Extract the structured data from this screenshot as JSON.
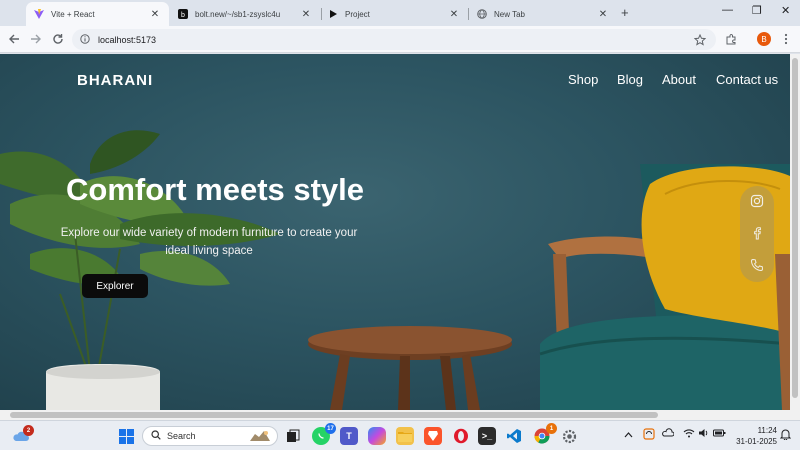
{
  "browser": {
    "tabs": [
      {
        "title": "Vite + React",
        "icon": "vite-icon",
        "active": true
      },
      {
        "title": "bolt.new/~/sb1-zsyslc4u",
        "icon": "bolt-icon",
        "active": false
      },
      {
        "title": "Project",
        "icon": "play-icon",
        "active": false
      },
      {
        "title": "New Tab",
        "icon": "globe-icon",
        "active": false
      }
    ],
    "new_tab_label": "+",
    "window_controls": {
      "minimize": "—",
      "restore": "❐",
      "close": "✕"
    },
    "url": "localhost:5173",
    "profile_initial": "B"
  },
  "site": {
    "brand": "BHARANI",
    "nav": [
      "Shop",
      "Blog",
      "About",
      "Contact us"
    ],
    "hero": {
      "title": "Comfort meets style",
      "subtitle": "Explore our wide variety of modern furniture to create your ideal living space",
      "cta": "Explorer"
    },
    "social": [
      "instagram-icon",
      "facebook-icon",
      "phone-icon"
    ],
    "colors": {
      "wall": "#2c5461",
      "cushion": "#e0a814",
      "chair_seat": "#1e5e62",
      "wood": "#7a4a28"
    }
  },
  "taskbar": {
    "weather_badge": "2",
    "search_placeholder": "Search",
    "whatsapp_badge": "17",
    "chrome_badge": "1",
    "clock_time": "11:24",
    "clock_date": "31-01-2025"
  }
}
